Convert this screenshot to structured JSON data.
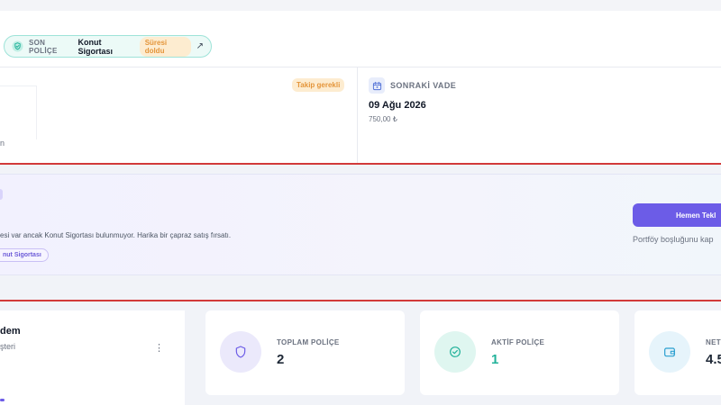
{
  "last_policy": {
    "label": "SON POLİÇE",
    "name": "Konut Sigortası",
    "status": "Süresi doldu",
    "arrow": "↗"
  },
  "follow_up": {
    "badge": "Takip gerekli",
    "cut_text": "n"
  },
  "next_due": {
    "label": "SONRAKİ VADE",
    "date": "09 Ağu 2026",
    "amount": "750,00 ₺"
  },
  "opportunity": {
    "text": "esi var ancak Konut Sigortası bulunmuyor. Harika bir çapraz satış fırsatı.",
    "tag": "nut Sigortası",
    "cta_label": "Hemen Tekl",
    "cta_sub": "Portföy boşluğunu kap"
  },
  "customer": {
    "name": "dem",
    "role": "şteri",
    "menu_icon": "⋮"
  },
  "stats": [
    {
      "label": "TOPLAM POLİÇE",
      "value": "2",
      "icon": "shield-icon",
      "color": "#6c5ce7"
    },
    {
      "label": "AKTİF POLİÇE",
      "value": "1",
      "icon": "check-shield-icon",
      "color": "#22b29a"
    },
    {
      "label": "NET",
      "value": "4.5",
      "icon": "wallet-icon",
      "color": "#2a9fd0"
    }
  ],
  "colors": {
    "accent": "#6c5ce7",
    "success": "#22b29a",
    "warning": "#e4953a",
    "annotation_red": "#d23a3a"
  }
}
